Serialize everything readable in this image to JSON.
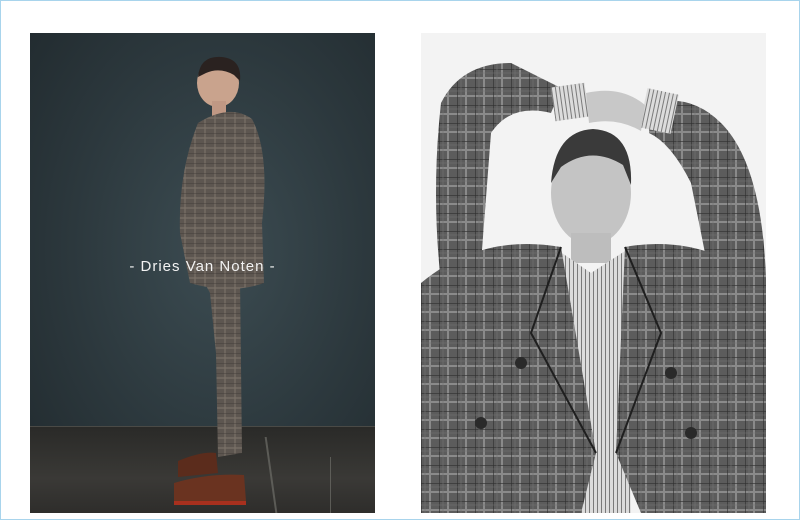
{
  "campaign": {
    "brand_caption": "- Dries Van Noten -"
  },
  "photos": [
    {
      "subject": "model-side-profile",
      "tone": "color"
    },
    {
      "subject": "model-arms-raised",
      "tone": "black-and-white"
    }
  ]
}
